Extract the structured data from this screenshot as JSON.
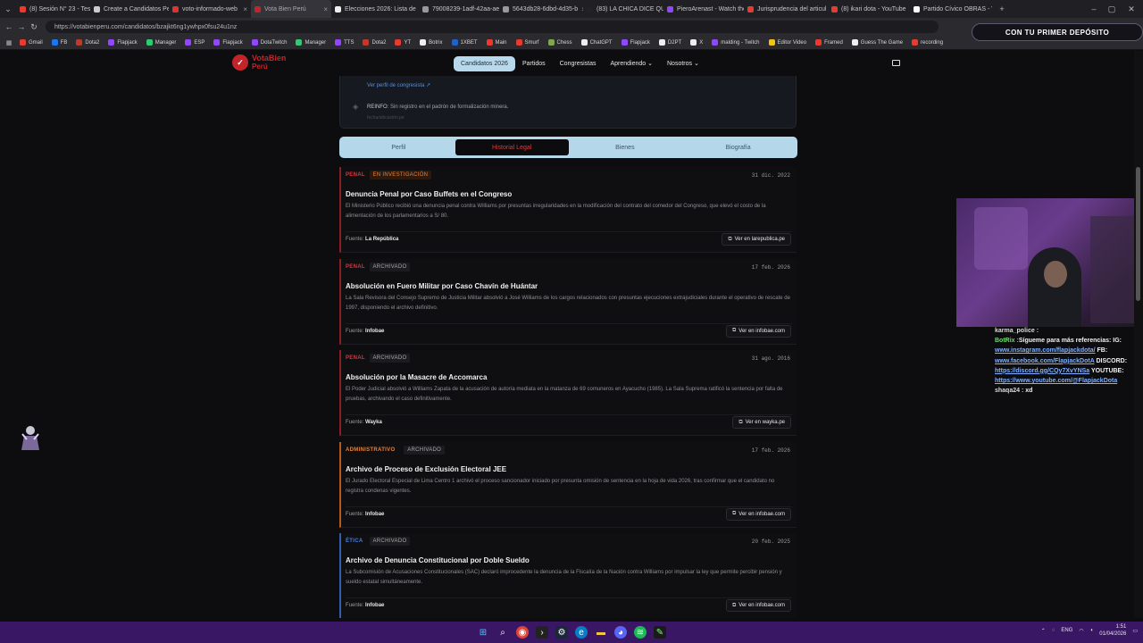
{
  "browser": {
    "tabs": [
      {
        "label": "(8) Sesión N° 23 - Testim",
        "color": "#e63b2e"
      },
      {
        "label": "Create a Candidatos Per",
        "color": "#cccccc"
      },
      {
        "label": "voto-informado-web",
        "color": "#d33"
      },
      {
        "label": "Vota Bien Perú",
        "color": "#c3242a",
        "active": true
      },
      {
        "label": "Elecciones 2026: Lista de",
        "color": "#eeeeee"
      },
      {
        "label": "79008239-1adf-42aa-ae",
        "color": "#999999"
      },
      {
        "label": "5643db28-6dbd-4d35-b",
        "color": "#999999"
      },
      {
        "label": "(83) LA CHICA DICE QUE",
        "color": "#222222"
      },
      {
        "label": "PieroArenast - Watch the",
        "color": "#9146ff"
      },
      {
        "label": "Jurisprudencia del articul",
        "color": "#e63b2e"
      },
      {
        "label": "(8) ikari dota - YouTube",
        "color": "#e63b2e"
      },
      {
        "label": "Partido Cívico OBRAS - V",
        "color": "#ffffff"
      }
    ],
    "url": "https://votabienperu.com/candidatos/bzajkt6ng1ywhpx0fsu24u1nz",
    "bookmarks": [
      {
        "label": "Gmail",
        "color": "#e63b2e"
      },
      {
        "label": "FB",
        "color": "#1877f2"
      },
      {
        "label": "Dota2",
        "color": "#c0392b"
      },
      {
        "label": "Flapjack",
        "color": "#9146ff"
      },
      {
        "label": "Manager",
        "color": "#2ecc71"
      },
      {
        "label": "ESP",
        "color": "#9146ff"
      },
      {
        "label": "Flapjack",
        "color": "#9146ff"
      },
      {
        "label": "DotaTwitch",
        "color": "#9146ff"
      },
      {
        "label": "Manager",
        "color": "#2ecc71"
      },
      {
        "label": "TTS",
        "color": "#9146ff"
      },
      {
        "label": "Dota2",
        "color": "#c0392b"
      },
      {
        "label": "YT",
        "color": "#e63b2e"
      },
      {
        "label": "Botrix",
        "color": "#eeeeee"
      },
      {
        "label": "1XBET",
        "color": "#1e64c8"
      },
      {
        "label": "Main",
        "color": "#e63b2e"
      },
      {
        "label": "Smurf",
        "color": "#e63b2e"
      },
      {
        "label": "Chess",
        "color": "#7fa650"
      },
      {
        "label": "ChatGPT",
        "color": "#eeeeee"
      },
      {
        "label": "Flapjack",
        "color": "#9146ff"
      },
      {
        "label": "D2PT",
        "color": "#eeeeee"
      },
      {
        "label": "X",
        "color": "#eeeeee"
      },
      {
        "label": "malding - Twitch",
        "color": "#9146ff"
      },
      {
        "label": "Editor Video",
        "color": "#f1c40f"
      },
      {
        "label": "Framed",
        "color": "#e63b2e"
      },
      {
        "label": "Guess The Game",
        "color": "#eeeeee"
      },
      {
        "label": "recording",
        "color": "#e63b2e"
      }
    ]
  },
  "site": {
    "logo_line1": "VotaBien",
    "logo_line2": "Perú",
    "nav": [
      {
        "label": "Candidatos 2026",
        "active": true
      },
      {
        "label": "Partidos"
      },
      {
        "label": "Congresistas"
      },
      {
        "label": "Aprendiendo ⌄"
      },
      {
        "label": "Nosotros ⌄"
      }
    ]
  },
  "top_card": {
    "link": "Ver perfil de congresista ↗",
    "reinfo_label": "REINFO",
    "reinfo_text": ": Sin registro en el padrón de formalización minera.",
    "source": "fecha/ubicación.pe"
  },
  "profile_tabs": [
    {
      "label": "Perfil"
    },
    {
      "label": "Historial Legal",
      "active": true
    },
    {
      "label": "Bienes"
    },
    {
      "label": "Biografía"
    }
  ],
  "records": [
    {
      "category": "PENAL",
      "category_color": "#d9363e",
      "status": "EN INVESTIGACIÓN",
      "status_color": "#e8833a",
      "status_bg": "#2a1a10",
      "date": "31 dic. 2022",
      "title": "Denuncia Penal por Caso Buffets en el Congreso",
      "description": "El Ministerio Público recibió una denuncia penal contra Williams por presuntas irregularidades en la modificación del contrato del comedor del Congreso, que elevó el costo de la alimentación de los parlamentarios a S/ 80.",
      "source_label": "Fuente:",
      "source": "La República",
      "button": "Ver en larepublica.pe",
      "border": "#8c1d22"
    },
    {
      "category": "PENAL",
      "category_color": "#d9363e",
      "status": "ARCHIVADO",
      "status_color": "#a8a8a8",
      "status_bg": "#1c1c20",
      "date": "17 feb. 2026",
      "title": "Absolución en Fuero Militar por Caso Chavín de Huántar",
      "description": "La Sala Revisora del Consejo Supremo de Justicia Militar absolvió a José Williams de los cargos relacionados con presuntas ejecuciones extrajudiciales durante el operativo de rescate de 1997, disponiendo el archivo definitivo.",
      "source_label": "Fuente:",
      "source": "Infobae",
      "button": "Ver en infobae.com",
      "border": "#8c1d22"
    },
    {
      "category": "PENAL",
      "category_color": "#d9363e",
      "status": "ARCHIVADO",
      "status_color": "#a8a8a8",
      "status_bg": "#1c1c20",
      "date": "31 ago. 2016",
      "title": "Absolución por la Masacre de Accomarca",
      "description": "El Poder Judicial absolvió a Williams Zapata de la acusación de autoría mediata en la matanza de 69 comuneros en Ayacucho (1985). La Sala Suprema ratificó la sentencia por falta de pruebas, archivando el caso definitivamente.",
      "source_label": "Fuente:",
      "source": "Wayka",
      "button": "Ver en wayka.pe",
      "border": "#8c1d22"
    },
    {
      "category": "ADMINISTRATIVO",
      "category_color": "#e8833a",
      "status": "ARCHIVADO",
      "status_color": "#a8a8a8",
      "status_bg": "#1c1c20",
      "date": "17 feb. 2026",
      "title": "Archivo de Proceso de Exclusión Electoral JEE",
      "description": "El Jurado Electoral Especial de Lima Centro 1 archivó el proceso sancionador iniciado por presunta omisión de sentencia en la hoja de vida 2026, tras confirmar que el candidato no registra condenas vigentes.",
      "source_label": "Fuente:",
      "source": "Infobae",
      "button": "Ver en infobae.com",
      "border": "#b85a1f"
    },
    {
      "category": "ÉTICA",
      "category_color": "#4a7fd9",
      "status": "ARCHIVADO",
      "status_color": "#a8a8a8",
      "status_bg": "#1c1c20",
      "date": "20 feb. 2025",
      "title": "Archivo de Denuncia Constitucional por Doble Sueldo",
      "description": "La Subcomisión de Acusaciones Constitucionales (SAC) declaró improcedente la denuncia de la Fiscalía de la Nación contra Williams por impulsar la ley que permite percibir pensión y sueldo estatal simultáneamente.",
      "source_label": "Fuente:",
      "source": "Infobae",
      "button": "Ver en infobae.com",
      "border": "#2f5fae"
    }
  ],
  "overlay": {
    "promo": "CON TU PRIMER DEPÓSITO",
    "chat": [
      {
        "user": "karma_police :",
        "text": "",
        "kind": "usr"
      },
      {
        "user": "BotRix :",
        "text": "Sígueme para más referencias: IG:",
        "kind": "bot"
      },
      {
        "user": "",
        "text": "www.instagram.com/flapjackdota/",
        "kind": "lnk",
        "after": " FB:"
      },
      {
        "user": "",
        "text": "www.facebook.com/FlapjackDotA",
        "kind": "lnk",
        "after": " DISCORD:"
      },
      {
        "user": "",
        "text": "https://discord.gg/CQy7XvYNSa",
        "kind": "lnk",
        "after": " YOUTUBE:"
      },
      {
        "user": "",
        "text": "https://www.youtube.com/@FlapjackDota",
        "kind": "lnk",
        "after": ""
      },
      {
        "user": "shaqa24 :",
        "text": " xd",
        "kind": "usr"
      }
    ]
  },
  "taskbar": {
    "lang": "ENG",
    "time": "1:51",
    "date": "01/04/2026"
  }
}
